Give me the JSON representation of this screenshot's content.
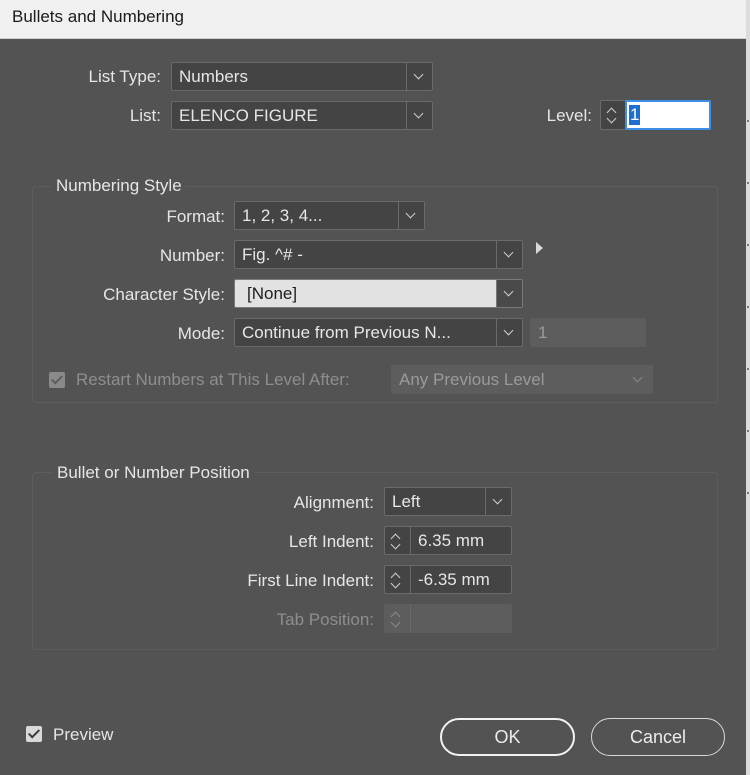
{
  "dialog": {
    "title": "Bullets and Numbering"
  },
  "list_type": {
    "label": "List Type:",
    "value": "Numbers"
  },
  "list": {
    "label": "List:",
    "value": "ELENCO FIGURE"
  },
  "level": {
    "label": "Level:",
    "value": "1"
  },
  "numbering_style": {
    "title": "Numbering Style",
    "format": {
      "label": "Format:",
      "value": "1, 2, 3, 4..."
    },
    "number": {
      "label": "Number:",
      "value": "Fig. ^# -"
    },
    "character_style": {
      "label": "Character Style:",
      "value": "[None]"
    },
    "mode": {
      "label": "Mode:",
      "value": "Continue from Previous N...",
      "start_value": "1"
    },
    "restart": {
      "label": "Restart Numbers at This Level After:",
      "value": "Any Previous Level",
      "checked": true,
      "disabled": true
    }
  },
  "position": {
    "title": "Bullet or Number Position",
    "alignment": {
      "label": "Alignment:",
      "value": "Left"
    },
    "left_indent": {
      "label": "Left Indent:",
      "value": "6.35 mm"
    },
    "first_line_indent": {
      "label": "First Line Indent:",
      "value": "-6.35 mm"
    },
    "tab_position": {
      "label": "Tab Position:",
      "value": "",
      "disabled": true
    }
  },
  "footer": {
    "preview_label": "Preview",
    "preview_checked": true,
    "ok_label": "OK",
    "cancel_label": "Cancel"
  },
  "colors": {
    "background": "#535353",
    "field": "#444444",
    "accent": "#1e6fd0",
    "titlebar": "#f0f0f0"
  }
}
